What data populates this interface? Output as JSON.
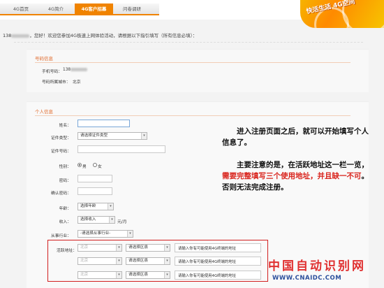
{
  "nav": {
    "tabs": [
      {
        "label": "4G首页"
      },
      {
        "label": "4G简介"
      },
      {
        "label": "4G客户招募"
      },
      {
        "label": "问卷调研"
      }
    ],
    "logo_text": "快活生活 4G空间"
  },
  "greeting": {
    "phone_prefix": "138",
    "message": "，您好！欢迎您参加4G极速上网体验活动，请根据以下指引填写（所有信息必填）："
  },
  "number_info": {
    "title": "号码信息",
    "phone_label": "手机号码：",
    "phone_value": "138",
    "city_label": "号码所属城市：",
    "city_value": "北京"
  },
  "personal_info": {
    "title": "个人信息",
    "fields": {
      "name": {
        "label": "姓名："
      },
      "id_type": {
        "label": "证件类型：",
        "selected": "请选择证件类型"
      },
      "id_number": {
        "label": "证件号码："
      },
      "gender": {
        "label": "性别：",
        "options": [
          "男",
          "女"
        ],
        "selected": "男"
      },
      "password": {
        "label": "密码："
      },
      "confirm_password": {
        "label": "确认密码："
      },
      "age": {
        "label": "年龄：",
        "selected": "选择年龄"
      },
      "income": {
        "label": "收入：",
        "selected": "选择收入",
        "unit": "元/月"
      },
      "industry": {
        "label": "从事行业：",
        "selected": "-请选择从事行业-"
      }
    },
    "address": {
      "label": "活跃地址：",
      "rows": [
        {
          "city": "北京",
          "district": "请选择区县",
          "placeholder": "请输入你有可能使用4G终端的地址"
        },
        {
          "city": "北京",
          "district": "请选择区县",
          "placeholder": "请输入你有可能使用4G终端的地址"
        },
        {
          "city": "北京",
          "district": "请选择区县",
          "placeholder": "请输入你有可能使用4G终端的地址"
        }
      ]
    }
  },
  "annotation": {
    "para1": "进入注册页面之后，就可以开始填写个人信息了。",
    "para2_a": "主要注意的是，在活跃地址这一栏一览，",
    "para2_red": "需要完整填写三个使用地址，并且缺一不可",
    "para2_b": "。否则无法完成注册。"
  },
  "watermark": {
    "cn": "中国自动识别网",
    "url": "WWW.CNAIDC.COM"
  },
  "colors": {
    "accent": "#f08300",
    "section_title": "#e0692a",
    "highlight_red": "#d9231c",
    "address_border": "#d21f1f",
    "watermark_blue": "#2b4f9c"
  }
}
